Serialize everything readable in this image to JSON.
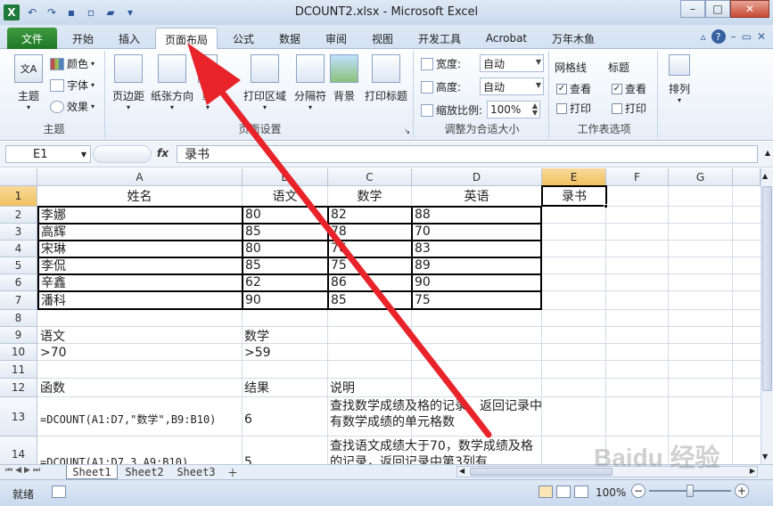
{
  "window": {
    "title": "DCOUNT2.xlsx - Microsoft Excel"
  },
  "tabs": [
    "文件",
    "开始",
    "插入",
    "页面布局",
    "公式",
    "数据",
    "审阅",
    "视图",
    "开发工具",
    "Acrobat",
    "万年木鱼"
  ],
  "ribbon": {
    "theme_group": {
      "label": "主题",
      "themes": "主题",
      "colors": "颜色",
      "fonts": "字体",
      "effects": "效果"
    },
    "page_setup": {
      "label": "页面设置",
      "margins": "页边距",
      "orientation": "纸张方向",
      "size": "纸",
      "print_area": "打印区域",
      "breaks": "分隔符",
      "background": "背景",
      "print_titles": "打印标题"
    },
    "scale": {
      "label": "调整为合适大小",
      "width_label": "宽度:",
      "width_value": "自动",
      "height_label": "高度:",
      "height_value": "自动",
      "scale_label": "缩放比例:",
      "scale_value": "100%"
    },
    "sheet_options": {
      "label": "工作表选项",
      "gridlines": "网格线",
      "headings": "标题",
      "view": "查看",
      "print": "打印"
    },
    "arrange": {
      "label": "排列"
    }
  },
  "formula_bar": {
    "name_box": "E1",
    "fx": "fx",
    "content": "录书"
  },
  "columns": [
    "A",
    "B",
    "C",
    "D",
    "E",
    "F",
    "G"
  ],
  "rows": [
    "1",
    "2",
    "3",
    "4",
    "5",
    "6",
    "7",
    "8",
    "9",
    "10",
    "11",
    "12",
    "13",
    "14"
  ],
  "cells": {
    "A1": "姓名",
    "B1": "语文",
    "C1": "数学",
    "D1": "英语",
    "E1": "录书",
    "A2": "李娜",
    "B2": "80",
    "C2": "82",
    "D2": "88",
    "A3": "高辉",
    "B3": "85",
    "C3": "78",
    "D3": "70",
    "A4": "宋琳",
    "B4": "80",
    "C4": "76",
    "D4": "83",
    "A5": "李侃",
    "B5": "85",
    "C5": "75",
    "D5": "89",
    "A6": "辛鑫",
    "B6": "62",
    "C6": "86",
    "D6": "90",
    "A7": "潘科",
    "B7": "90",
    "C7": "85",
    "D7": "75",
    "A9": "语文",
    "B9": "数学",
    "A10": ">70",
    "B10": ">59",
    "A12": "函数",
    "B12": "结果",
    "C12": "说明",
    "A13": "=DCOUNT(A1:D7,\"数学\",B9:B10)",
    "B13": "6",
    "C13": "查找数学成绩及格的记录，返回记录中有数学成绩的单元格数",
    "A14": "=DCOUNT(A1:D7,3,A9:B10)",
    "B14": "5",
    "C14": "查找语文成绩大于70，数学成绩及格的记录，返回记录中第3列有"
  },
  "sheets": [
    "Sheet1",
    "Sheet2",
    "Sheet3"
  ],
  "status": {
    "ready": "就绪",
    "zoom": "100%"
  },
  "watermark": "Baidu 经验"
}
